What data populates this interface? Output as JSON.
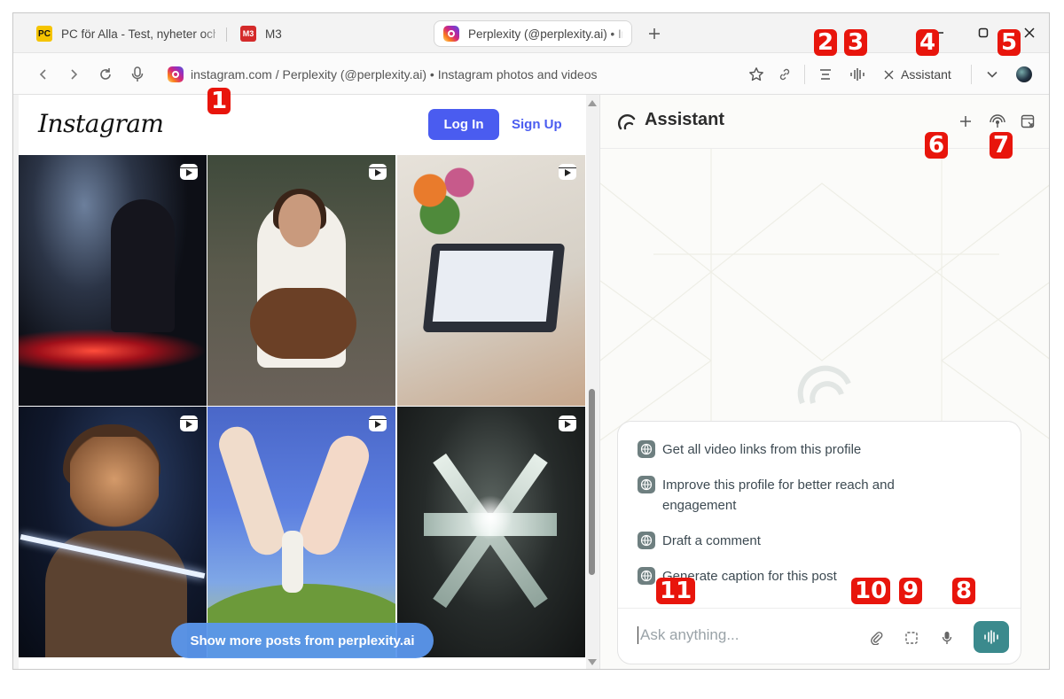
{
  "tabs": [
    {
      "label": "PC för Alla - Test, nyheter och",
      "icon": "PC"
    },
    {
      "label": "M3",
      "icon": "M3"
    },
    {
      "label": "Perplexity (@perplexity.ai) • In",
      "active": true
    }
  ],
  "address": {
    "url": "instagram.com / Perplexity (@perplexity.ai) • Instagram photos and videos"
  },
  "toolbar": {
    "assistant_label": "Assistant"
  },
  "instagram": {
    "logo": "Instagram",
    "login_label": "Log In",
    "signup_label": "Sign Up",
    "show_more": "Show more posts from perplexity.ai"
  },
  "assistant": {
    "title": "Assistant",
    "suggestions": [
      "Get all video links from this profile",
      "Improve this profile for better reach and engagement",
      "Draft a comment",
      "Generate caption for this post"
    ],
    "placeholder": "Ask anything..."
  },
  "annotations": [
    "1",
    "2",
    "3",
    "4",
    "5",
    "6",
    "7",
    "8",
    "9",
    "10",
    "11"
  ],
  "colors": {
    "login_blue": "#4a5cf0",
    "voice_teal": "#3b8a8d",
    "badge_red": "#e8150c"
  }
}
